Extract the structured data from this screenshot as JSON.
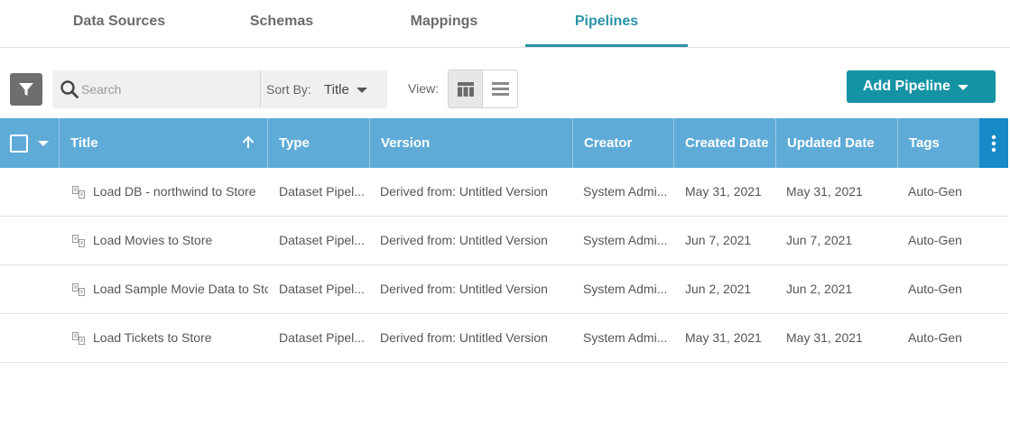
{
  "tabs": [
    {
      "label": "Data Sources",
      "active": false
    },
    {
      "label": "Schemas",
      "active": false
    },
    {
      "label": "Mappings",
      "active": false
    },
    {
      "label": "Pipelines",
      "active": true
    }
  ],
  "toolbar": {
    "filter_icon": "filter-icon",
    "search_placeholder": "Search",
    "sort_label": "Sort By:",
    "sort_value": "Title",
    "view_label": "View:",
    "views": [
      "grid-view-icon",
      "list-view-icon"
    ],
    "add_button_label": "Add Pipeline"
  },
  "table": {
    "columns": [
      "Title",
      "Type",
      "Version",
      "Creator",
      "Created Date",
      "Updated Date",
      "Tags"
    ],
    "sort_column": "Title",
    "sort_direction": "ascending",
    "rows": [
      {
        "title": "Load DB - northwind to Store",
        "type": "Dataset Pipel...",
        "version": "Derived from: Untitled Version",
        "creator": "System Admi...",
        "created": "May 31, 2021",
        "updated": "May 31, 2021",
        "tags": "Auto-Gen"
      },
      {
        "title": "Load Movies to Store",
        "type": "Dataset Pipel...",
        "version": "Derived from: Untitled Version",
        "creator": "System Admi...",
        "created": "Jun 7, 2021",
        "updated": "Jun 7, 2021",
        "tags": "Auto-Gen"
      },
      {
        "title": "Load Sample Movie Data to Store",
        "type": "Dataset Pipel...",
        "version": "Derived from: Untitled Version",
        "creator": "System Admi...",
        "created": "Jun 2, 2021",
        "updated": "Jun 2, 2021",
        "tags": "Auto-Gen"
      },
      {
        "title": "Load Tickets to Store",
        "type": "Dataset Pipel...",
        "version": "Derived from: Untitled Version",
        "creator": "System Admi...",
        "created": "May 31, 2021",
        "updated": "May 31, 2021",
        "tags": "Auto-Gen"
      }
    ]
  },
  "colors": {
    "accent": "#1493a5",
    "tab_active": "#2a93a8",
    "header_bg": "#5fabd8",
    "header_menu_bg": "#178bc7"
  }
}
